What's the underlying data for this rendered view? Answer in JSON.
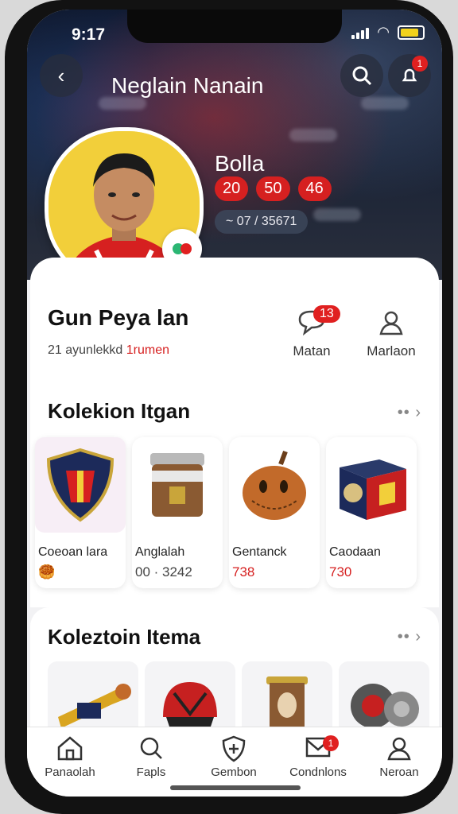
{
  "status": {
    "time": "9:17"
  },
  "header": {
    "title": "Neglain Nanain",
    "notification_count": "1"
  },
  "hero": {
    "label": "Bolla",
    "stats": [
      "20",
      "50",
      "46"
    ],
    "code": "~ 07 / 35671"
  },
  "profile": {
    "name": "Gun Peya lan",
    "subtitle_prefix": "21 ayunlekkd",
    "subtitle_highlight": "1rumen"
  },
  "actions": [
    {
      "label": "Matan",
      "icon": "chat-bubble-icon",
      "badge": "13"
    },
    {
      "label": "Marlaon",
      "icon": "user-icon"
    }
  ],
  "collection1": {
    "title": "Kolekion Itgan",
    "more": "•• ›",
    "items": [
      {
        "name": "Coeoan lara",
        "value": "🥮",
        "icon": "club-crest-icon"
      },
      {
        "name": "Anglalah",
        "value": "00 · 3242",
        "icon": "jar-icon"
      },
      {
        "name": "Gentanck",
        "value": "738",
        "icon": "gourd-ball-icon"
      },
      {
        "name": "Caodaan",
        "value": "730",
        "icon": "gift-box-icon"
      }
    ]
  },
  "collection2": {
    "title": "Koleztoin Itema",
    "more": "•• ›",
    "items": [
      {
        "icon": "trophy-horn-icon"
      },
      {
        "icon": "helmet-icon"
      },
      {
        "icon": "wooden-idol-icon"
      },
      {
        "icon": "engine-part-icon"
      }
    ]
  },
  "tabs": [
    {
      "label": "Panaolah",
      "icon": "home-icon"
    },
    {
      "label": "Fapls",
      "icon": "search-icon"
    },
    {
      "label": "Gembon",
      "icon": "shield-icon"
    },
    {
      "label": "Condnlons",
      "icon": "mail-icon",
      "badge": "1"
    },
    {
      "label": "Neroan",
      "icon": "user-icon"
    }
  ]
}
